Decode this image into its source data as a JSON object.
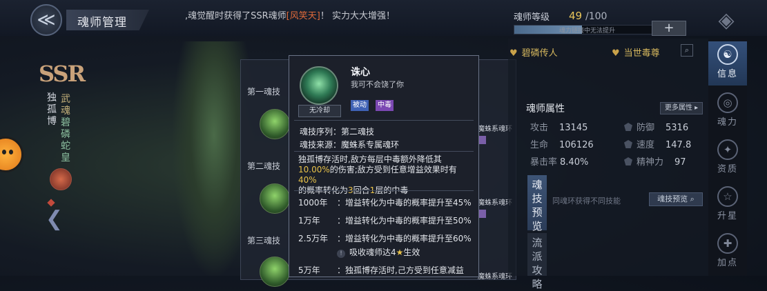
{
  "header": {
    "title": "魂师管理",
    "marquee_pre": ",魂觉醒时获得了SSR魂师",
    "marquee_name": "[风笑天]",
    "marquee_post": "！ 实力大大增强！",
    "level_label": "魂师等级",
    "level_current": "49",
    "level_max": "/100",
    "level_progress": 0.49,
    "level_hint": "魂力链接中无法提升",
    "plus_label": "+"
  },
  "hero": {
    "rarity": "SSR",
    "name": "独孤博",
    "title_line1": "武魂",
    "title_line2": "碧磷蛇皇"
  },
  "skills_panel": {
    "rows": [
      {
        "label": "第一魂技",
        "ring": "魔蛛系魂环"
      },
      {
        "label": "第二魂技",
        "ring": "魔蛛系魂环"
      },
      {
        "label": "第三魂技",
        "ring": "魔蛛系魂环"
      }
    ]
  },
  "right_panel": {
    "fetter1": "碧磷传人",
    "fetter2": "当世毒尊",
    "attr_title": "魂师属性",
    "more_attr": "更多属性",
    "stats": [
      {
        "name": "攻击",
        "value": "13145"
      },
      {
        "name": "防御",
        "value": "5316"
      },
      {
        "name": "生命",
        "value": "106126"
      },
      {
        "name": "速度",
        "value": "147.8"
      },
      {
        "name": "暴击率",
        "value": "8.40%"
      },
      {
        "name": "精神力",
        "value": "97"
      }
    ],
    "preview_tab": "魂技预览",
    "flow_tab": "流派攻略",
    "ring_hint": "同魂环获得不同技能",
    "ring_preview_btn": "魂技预览"
  },
  "side_nav": [
    {
      "label": "信息",
      "icon": "info-icon",
      "active": true
    },
    {
      "label": "魂力",
      "icon": "soul-power-icon",
      "active": false
    },
    {
      "label": "资质",
      "icon": "aptitude-icon",
      "active": false
    },
    {
      "label": "升星",
      "icon": "star-up-icon",
      "active": false
    },
    {
      "label": "加点",
      "icon": "add-point-icon",
      "active": false
    }
  ],
  "tooltip": {
    "skill_name": "诛心",
    "quote": "我可不会饶了你",
    "cooldown": "无冷却",
    "tag_passive": "被动",
    "tag_poison": "中毒",
    "order_label": "魂技序列：",
    "order_value": "第二魂技",
    "source_label": "魂技来源：",
    "source_value": "魔蛛系专属魂环",
    "desc_a": "独孤博存活时,敌方每层中毒额外降低其",
    "desc_b": "10.00%",
    "desc_c": "的伤害;敌方受到任意增益效果时有",
    "desc_d": "40%",
    "desc_e": "的概率转化为",
    "desc_f": "3",
    "desc_g": "回合",
    "desc_h": "1",
    "desc_i": "层的中毒",
    "upgrades": [
      {
        "year": "1000年",
        "text": "增益转化为中毒的概率提升至45%"
      },
      {
        "year": "1万年",
        "text": "增益转化为中毒的概率提升至50%"
      },
      {
        "year": "2.5万年",
        "text": "增益转化为中毒的概率提升至60%"
      }
    ],
    "req_pre": "吸收魂师达4",
    "req_post": "生效",
    "last_year": "5万年",
    "last_text": "独孤博存活时,己方受到任意减益"
  }
}
